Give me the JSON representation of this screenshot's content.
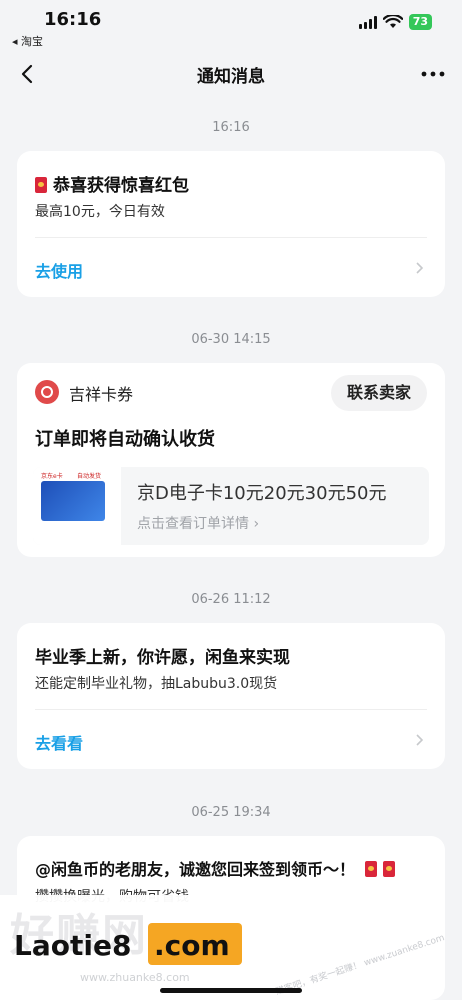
{
  "status_bar": {
    "time": "16:16",
    "back_app": "◂ 淘宝",
    "battery": "73"
  },
  "nav": {
    "title": "通知消息"
  },
  "messages": [
    {
      "timestamp": "16:16",
      "title": "恭喜获得惊喜红包",
      "subtitle": "最高10元，今日有效",
      "action": "去使用"
    },
    {
      "timestamp": "06-30 14:15",
      "shop_name": "吉祥卡券",
      "contact_button": "联系卖家",
      "title": "订单即将自动确认收货",
      "product_name": "京D电子卡10元20元30元50元",
      "product_link": "点击查看订单详情 ›",
      "thumb_tag_left": "京东e卡",
      "thumb_tag_right": "自动发货"
    },
    {
      "timestamp": "06-26 11:12",
      "title": "毕业季上新，你许愿，闲鱼来实现",
      "subtitle": "还能定制毕业礼物，抽Labubu3.0现货",
      "action": "去看看"
    },
    {
      "timestamp": "06-25 19:34",
      "title": "@闲鱼币的老朋友，诚邀您回来签到领币～！",
      "subtitle": "攒攒换曝光，购物可省钱"
    }
  ],
  "watermark": {
    "faint": "好赚网",
    "brand": "Laotie8",
    "suffix": ".com",
    "small": "www.zhuanke8.com",
    "diagonal": "赚客吧，有奖一起赚！ www.zuanke8.com"
  },
  "colors": {
    "accent": "#1aa0e6",
    "background": "#f3f4f6",
    "battery": "#34c759",
    "watermark": "#f5a623"
  }
}
